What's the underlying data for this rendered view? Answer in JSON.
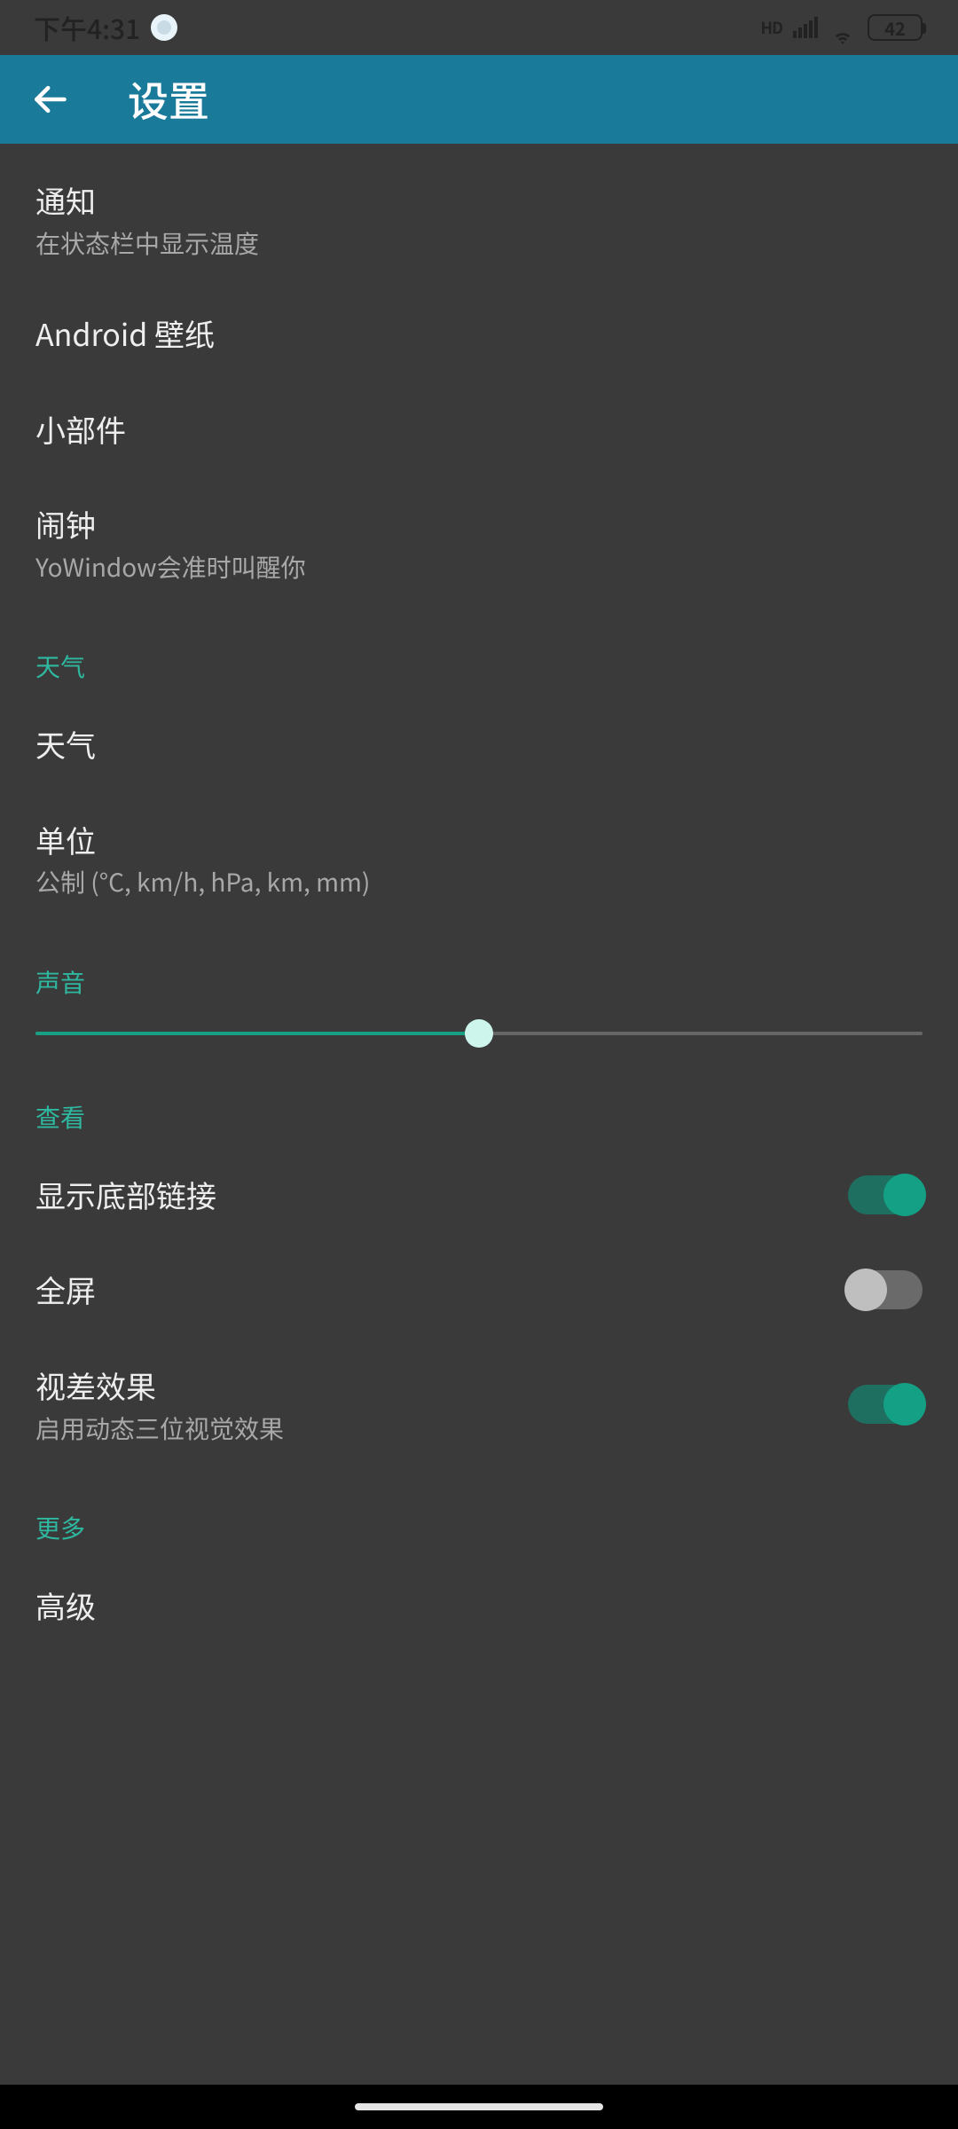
{
  "status": {
    "time": "下午4:31",
    "battery": "42"
  },
  "header": {
    "title": "设置"
  },
  "items": {
    "notif": {
      "title": "通知",
      "sub": "在状态栏中显示温度"
    },
    "wallpaper": {
      "title": "Android 壁纸"
    },
    "widgets": {
      "title": "小部件"
    },
    "alarm": {
      "title": "闹钟",
      "sub": "YoWindow会准时叫醒你"
    }
  },
  "sections": {
    "weather": {
      "header": "天气",
      "weather": "天气",
      "units_title": "单位",
      "units_sub": "公制  (°C, km/h, hPa, km, mm)"
    },
    "sound": {
      "header": "声音",
      "slider_pct": 50
    },
    "view": {
      "header": "查看",
      "links": {
        "title": "显示底部链接",
        "on": true
      },
      "fullscreen": {
        "title": "全屏",
        "on": false
      },
      "parallax": {
        "title": "视差效果",
        "sub": "启用动态三位视觉效果",
        "on": true
      }
    },
    "more": {
      "header": "更多",
      "advanced": "高级"
    }
  }
}
